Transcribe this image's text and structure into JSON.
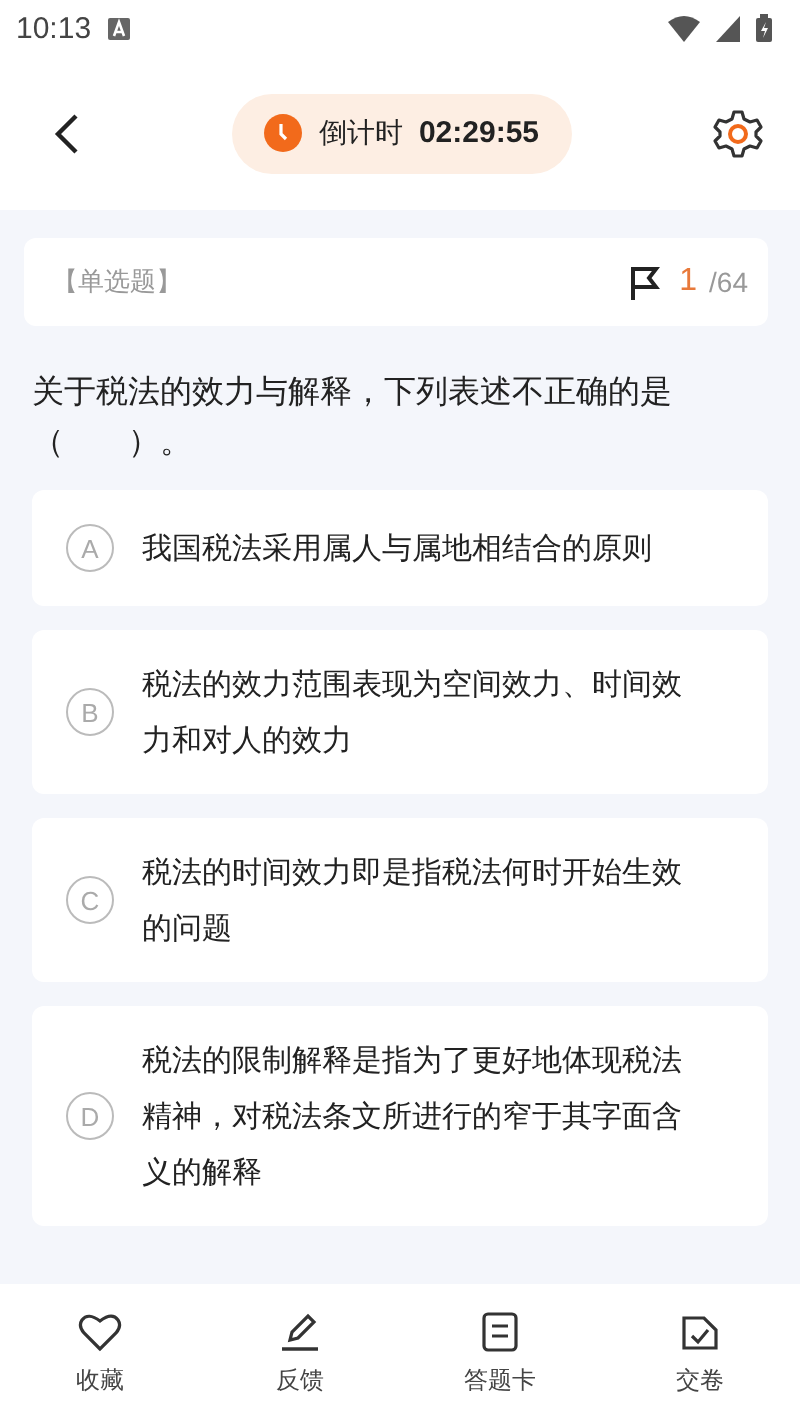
{
  "status_bar": {
    "time": "10:13"
  },
  "header": {
    "timer_label": "倒计时",
    "timer_value": "02:29:55"
  },
  "question": {
    "type": "【单选题】",
    "current": "1",
    "total": "/64",
    "text": "关于税法的效力与解释，下列表述不正确的是（　　）。"
  },
  "options": [
    {
      "letter": "A",
      "text": "我国税法采用属人与属地相结合的原则",
      "selected": false
    },
    {
      "letter": "B",
      "text": "税法的效力范围表现为空间效力、时间效力和对人的效力",
      "selected": false
    },
    {
      "letter": "C",
      "text": "税法的时间效力即是指税法何时开始生效的问题",
      "selected": false
    },
    {
      "letter": "D",
      "text": "税法的限制解释是指为了更好地体现税法精神，对税法条文所进行的窄于其字面含义的解释",
      "selected": false
    }
  ],
  "bottom_bar": [
    {
      "kind": "favorite",
      "label": "收藏"
    },
    {
      "kind": "feedback",
      "label": "反馈"
    },
    {
      "kind": "card",
      "label": "答题卡"
    },
    {
      "kind": "submit",
      "label": "交卷"
    }
  ]
}
